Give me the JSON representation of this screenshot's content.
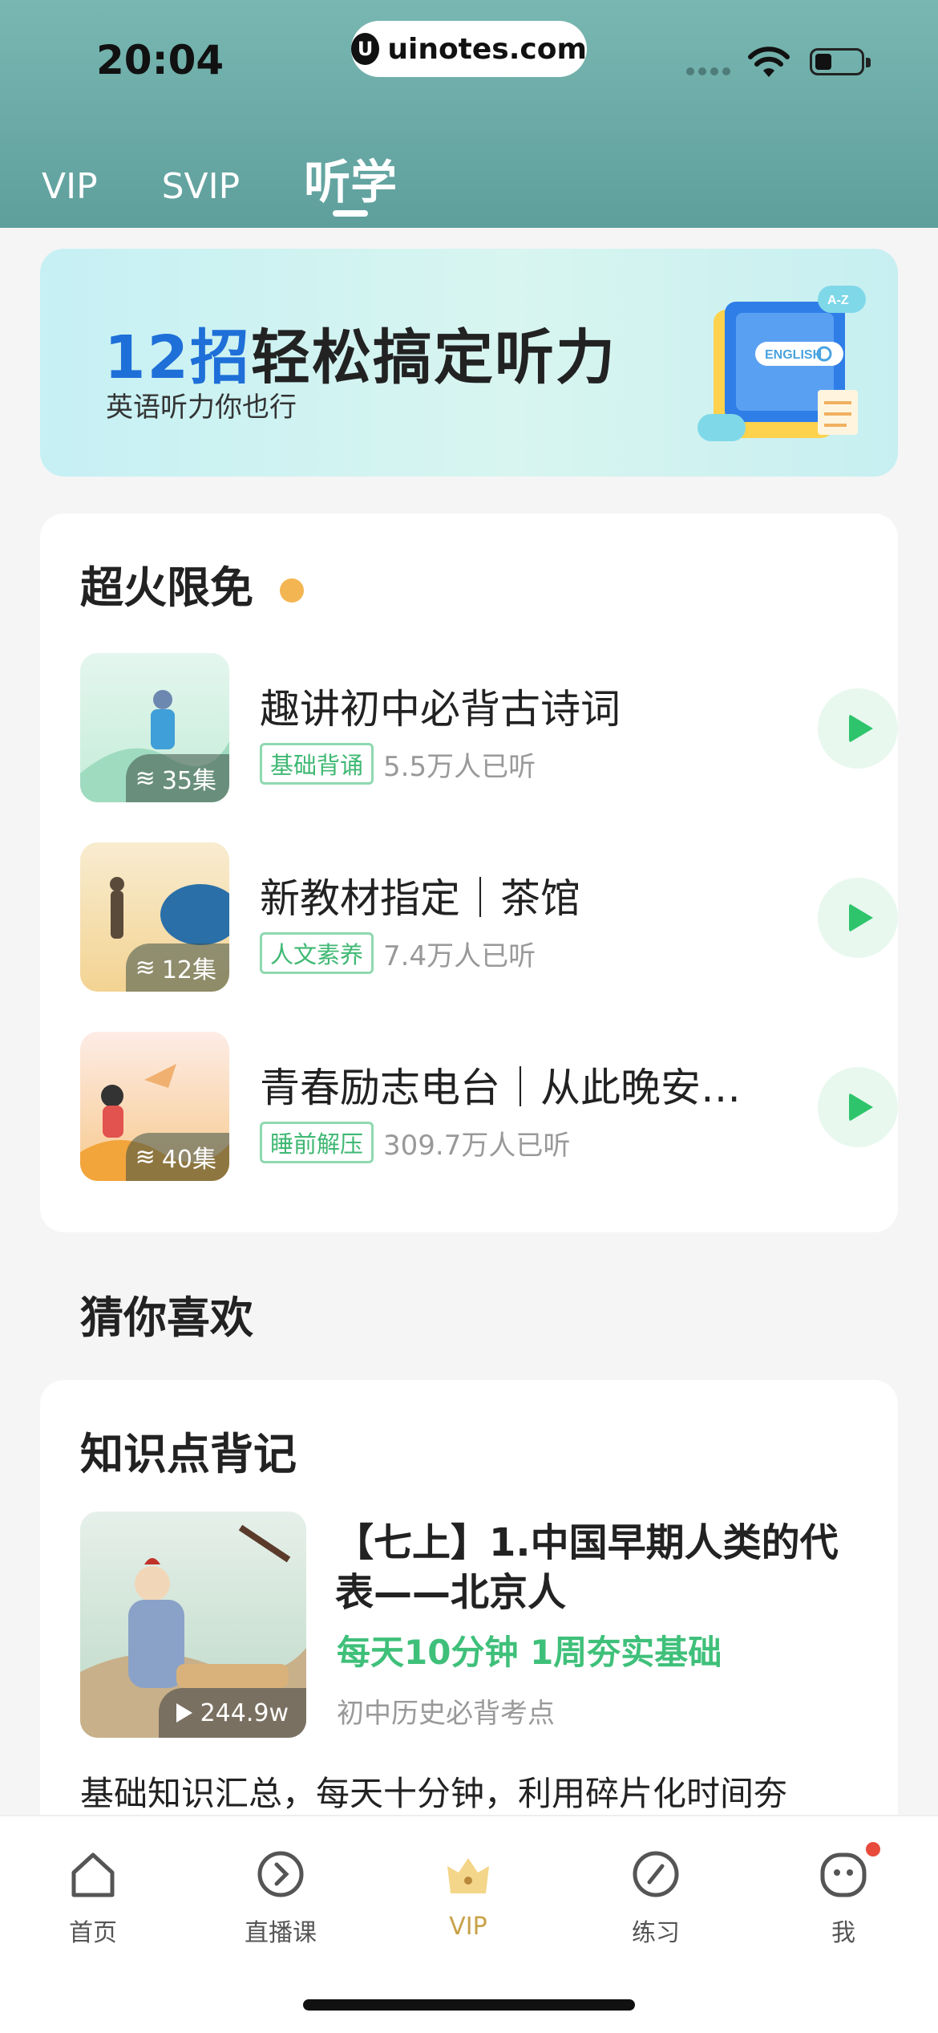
{
  "status_bar": {
    "time": "20:04",
    "url": "uinotes.com"
  },
  "top_tabs": [
    {
      "label": "VIP"
    },
    {
      "label": "SVIP"
    },
    {
      "label": "听学",
      "active": true
    }
  ],
  "banner": {
    "title_highlight": "12招",
    "title_rest": "轻松搞定听力",
    "subtitle": "英语听力你也行",
    "tablet_tag": "A-Z",
    "tablet_text": "ENGLISH"
  },
  "hot_section": {
    "title": "超火限免",
    "items": [
      {
        "title": "趣讲初中必背古诗词",
        "tag": "基础背诵",
        "listeners": "5.5万人已听",
        "episodes": "35集"
      },
      {
        "title": "新教材指定｜茶馆",
        "tag": "人文素养",
        "listeners": "7.4万人已听",
        "episodes": "12集"
      },
      {
        "title": "青春励志电台｜从此晚安…",
        "tag": "睡前解压",
        "listeners": "309.7万人已听",
        "episodes": "40集"
      }
    ]
  },
  "guess_section": {
    "title": "猜你喜欢"
  },
  "knowledge_card": {
    "title": "知识点背记",
    "item_title": "【七上】1.中国早期人类的代表——北京人",
    "slogan": "每天10分钟 1周夯实基础",
    "category": "初中历史必背考点",
    "plays": "244.9w",
    "description": "基础知识汇总，每天十分钟，利用碎片化时间夯"
  },
  "bottom_nav": [
    {
      "label": "首页",
      "icon": "home-icon"
    },
    {
      "label": "直播课",
      "icon": "live-icon"
    },
    {
      "label": "VIP",
      "icon": "crown-icon",
      "active": true
    },
    {
      "label": "练习",
      "icon": "pencil-icon"
    },
    {
      "label": "我",
      "icon": "profile-icon",
      "badge": true
    }
  ],
  "colors": {
    "header": "#6aa9a6",
    "accent_green": "#3fc07a",
    "active_nav": "#c8a24a",
    "banner_blue": "#1e6fd8"
  }
}
